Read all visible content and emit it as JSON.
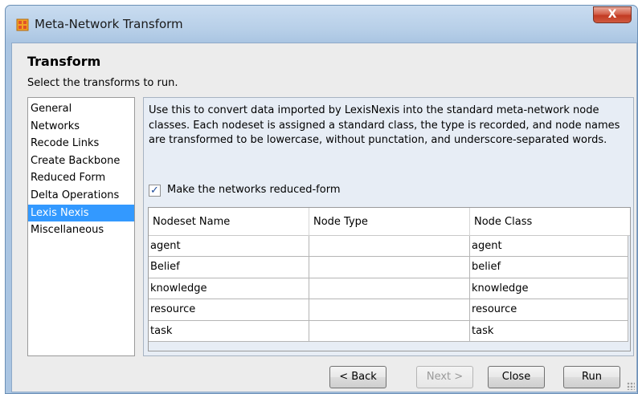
{
  "window": {
    "title": "Meta-Network Transform",
    "close_label": "X"
  },
  "header": {
    "title": "Transform",
    "subtitle": "Select the transforms to run."
  },
  "nav": {
    "items": [
      {
        "label": "General"
      },
      {
        "label": "Networks"
      },
      {
        "label": "Recode Links"
      },
      {
        "label": "Create Backbone"
      },
      {
        "label": "Reduced Form"
      },
      {
        "label": "Delta Operations"
      },
      {
        "label": "Lexis Nexis",
        "selected": true
      },
      {
        "label": "Miscellaneous"
      }
    ]
  },
  "panel": {
    "description": "Use this to convert data imported by LexisNexis into the standard meta-network node classes. Each nodeset is assigned a standard class, the type is recorded, and node names are transformed to be lowercase, without punctation, and underscore-separated words.",
    "checkbox": {
      "label": "Make the networks reduced-form",
      "checked": true
    },
    "table": {
      "columns": [
        "Nodeset Name",
        "Node Type",
        "Node Class"
      ],
      "rows": [
        [
          "agent",
          "",
          "agent"
        ],
        [
          "Belief",
          "",
          "belief"
        ],
        [
          "knowledge",
          "",
          "knowledge"
        ],
        [
          "resource",
          "",
          "resource"
        ],
        [
          "task",
          "",
          "task"
        ]
      ]
    }
  },
  "buttons": {
    "back": "< Back",
    "next": "Next >",
    "close": "Close",
    "run": "Run"
  },
  "colors": {
    "selection": "#3399ff",
    "close_button": "#c23a22",
    "title_bar": "#b7cfe8",
    "checkmark": "#1c4a9a"
  },
  "icons": {
    "app": "grid-app-icon",
    "checkbox": "checkmark-icon"
  }
}
